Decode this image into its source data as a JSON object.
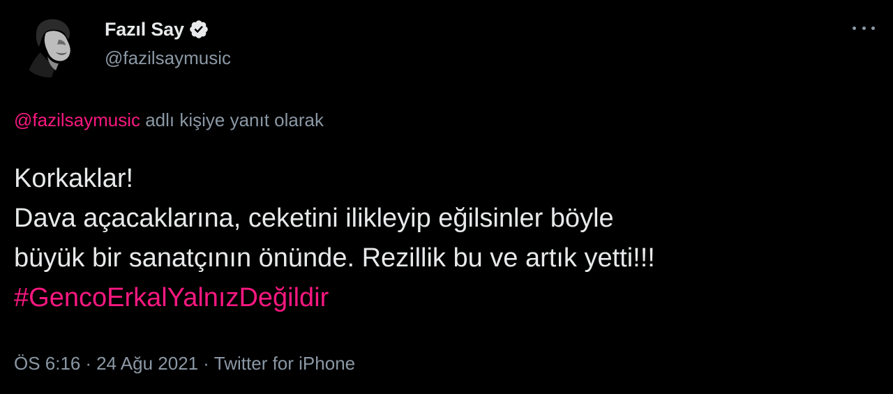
{
  "author": {
    "display_name": "Fazıl Say",
    "handle": "@fazilsaymusic",
    "verified": true
  },
  "reply": {
    "mention": "@fazilsaymusic",
    "suffix": " adlı kişiye yanıt olarak"
  },
  "tweet": {
    "lines": [
      "Korkaklar!",
      "Dava açacaklarına, ceketini ilikleyip eğilsinler böyle",
      "büyük bir sanatçının önünde. Rezillik bu ve artık yetti!!!"
    ],
    "hashtag": "#GencoErkalYalnızDeğildir"
  },
  "meta": {
    "time": "ÖS 6:16",
    "separator": "·",
    "date": "24 Ağu 2021",
    "source": "Twitter for iPhone"
  },
  "icons": {
    "verified": "verified-badge-icon",
    "more": "more-options-icon"
  },
  "colors": {
    "background": "#000000",
    "text": "#e7e9ea",
    "secondary": "#8b98a5",
    "accent": "#f91880"
  }
}
